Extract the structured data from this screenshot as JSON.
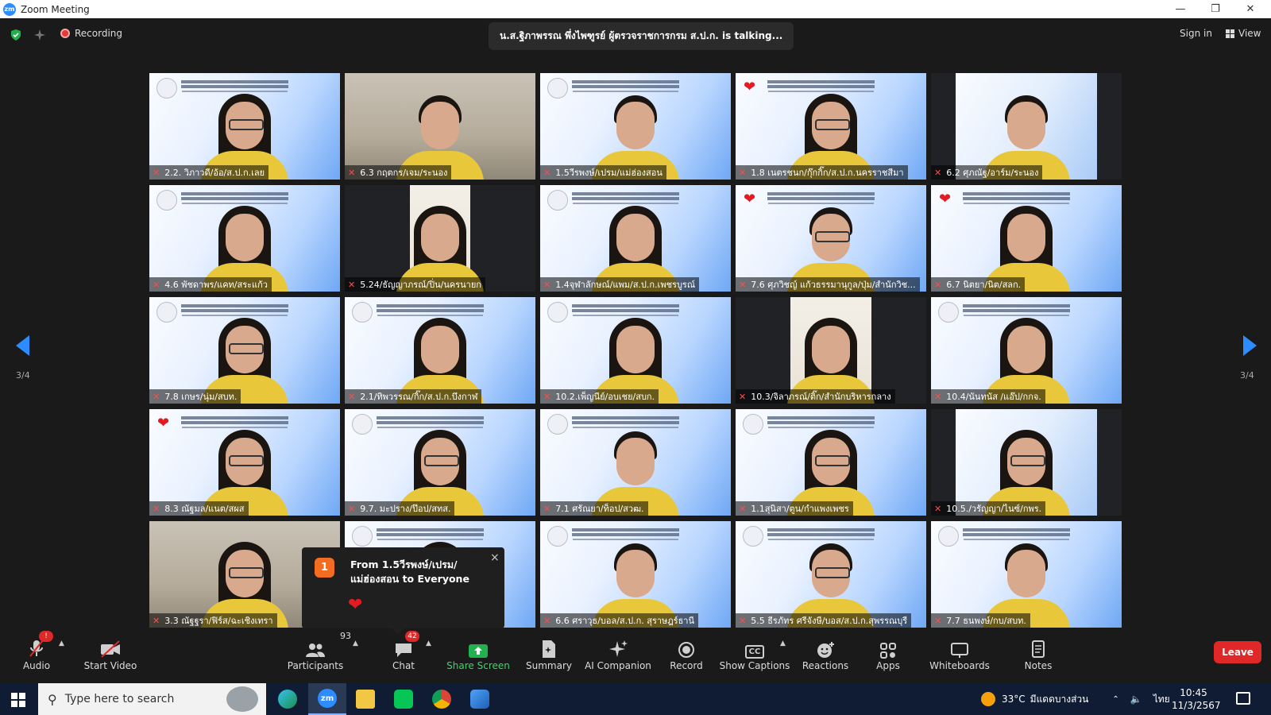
{
  "window": {
    "title": "Zoom Meeting",
    "logo_text": "zm"
  },
  "topbar": {
    "recording_label": "Recording",
    "talking": "น.ส.ฐิภาพรรณ พึ่งไพฑูรย์ ผู้ตรวจราชการกรม ส.ป.ก. is talking...",
    "sign_in": "Sign in",
    "view": "View"
  },
  "pagination": {
    "current": "3/4"
  },
  "participants": [
    {
      "name": "2.2. วิภาวดี/อ้อ/ส.ป.ก.เลย",
      "bg": "banner",
      "heart": false
    },
    {
      "name": "6.3 กฤตกร/เจม/ระนอง",
      "bg": "room",
      "heart": false
    },
    {
      "name": "1.5วีรพงษ์/เปรม/แม่ฮ่องสอน",
      "bg": "banner",
      "heart": false
    },
    {
      "name": "1.8 เนตรชนก/กุ๊กกิ๊ก/ส.ป.ก.นครราชสีมา",
      "bg": "banner",
      "heart": true
    },
    {
      "name": "6.2 ศุภณัฐ/อาร์ม/ระนอง",
      "bg": "inner",
      "heart": false
    },
    {
      "name": "4.6 พัชดาพร/แคท/สระแก้ว",
      "bg": "banner",
      "heart": false
    },
    {
      "name": "5.24/ธัญญาภรณ์/ปิ่น/นครนายก",
      "bg": "innerwall",
      "heart": false
    },
    {
      "name": "1.4จุฬาลักษณ์/แพม/ส.ป.ก.เพชรบูรณ์",
      "bg": "banner",
      "heart": false
    },
    {
      "name": "7.6 ศุภวิชญ์ แก้วธรรมานุกูล/ปุ่ม/สำนักวิช...",
      "bg": "banner",
      "heart": true
    },
    {
      "name": "6.7 นิตยา/นิต/สลก.",
      "bg": "banner",
      "heart": true
    },
    {
      "name": "7.8 เกษร/นุ่ม/สบท.",
      "bg": "banner",
      "heart": false
    },
    {
      "name": "2.1/ทิพวรรณ/กิ๊ก/ส.ป.ก.บึงกาฬ",
      "bg": "banner",
      "heart": false
    },
    {
      "name": "10.2.เพ็ญนีย์/อบเชย/สบก.",
      "bg": "banner",
      "heart": false
    },
    {
      "name": "10.3/จิลาภรณ์/ติ๊ก/สำนักบริหารกลาง",
      "bg": "innerwall",
      "heart": false
    },
    {
      "name": "10.4/นันทนัส /แอ๊ป/กกจ.",
      "bg": "banner",
      "heart": false
    },
    {
      "name": "8.3 ณัฐมล/แนต/สผส",
      "bg": "banner",
      "heart": true
    },
    {
      "name": "9.7. มะปราง/ป๊อป/สทส.",
      "bg": "banner",
      "heart": false
    },
    {
      "name": "7.1 ศรัณยา/ท็อป/สวฒ.",
      "bg": "banner",
      "heart": false
    },
    {
      "name": "1.1สุนิสา/ตูน/กำแพงเพชร",
      "bg": "banner",
      "heart": false
    },
    {
      "name": "10.5./วรัญญา/ไนซ์/กพร.",
      "bg": "inner",
      "heart": false
    },
    {
      "name": "3.3 ณัฐฐรา/ฟิร์ส/ฉะเชิงเทรา",
      "bg": "room",
      "heart": false
    },
    {
      "name": "",
      "bg": "banner",
      "heart": false
    },
    {
      "name": "6.6 ศราวุธ/บอล/ส.ป.ก. สุราษฎร์ธานี",
      "bg": "banner",
      "heart": false
    },
    {
      "name": "5.5 ธีรภัทร ศรีจังษี/บอส/ส.ป.ก.สุพรรณบุรี",
      "bg": "banner",
      "heart": false
    },
    {
      "name": "7.7 ธนพงษ์/กบ/สบท.",
      "bg": "banner",
      "heart": false
    }
  ],
  "chat_popup": {
    "count": "1",
    "message": "From 1.5วีรพงษ์/เปรม/แม่ฮ่องสอน to Everyone",
    "close_glyph": "×",
    "reaction": "❤"
  },
  "toolbar": {
    "audio": "Audio",
    "audio_badge": "!",
    "start_video": "Start Video",
    "participants": "Participants",
    "participants_count": "93",
    "chat": "Chat",
    "chat_badge": "42",
    "share_screen": "Share Screen",
    "summary": "Summary",
    "ai_companion": "AI Companion",
    "record": "Record",
    "show_captions": "Show Captions",
    "cc": "CC",
    "reactions": "Reactions",
    "apps": "Apps",
    "whiteboards": "Whiteboards",
    "notes": "Notes",
    "leave": "Leave"
  },
  "taskbar": {
    "search_placeholder": "Type here to search",
    "weather": "33°C",
    "weather_desc": "มีแดดบางส่วน",
    "lang": "ไทย",
    "time": "10:45",
    "date": "11/3/2567",
    "zoom_label": "zm"
  },
  "colors": {
    "accent": "#2d8cff",
    "leave": "#e02828",
    "share": "#22b14c",
    "badge": "#f26d21",
    "heart": "#e31b23"
  }
}
